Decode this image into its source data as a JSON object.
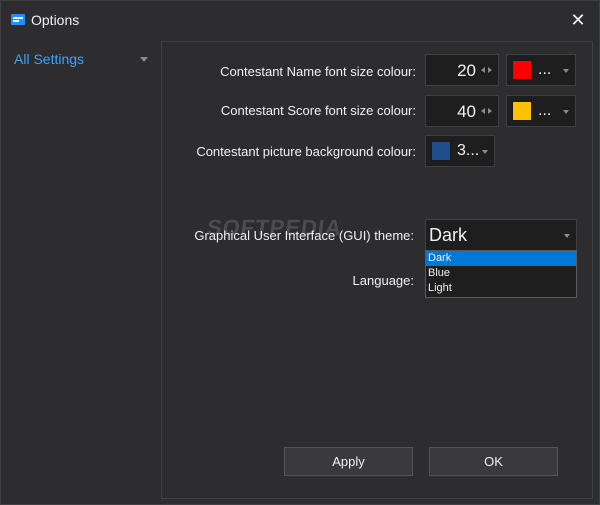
{
  "window": {
    "title": "Options",
    "close_glyph": "✕"
  },
  "sidebar": {
    "items": [
      {
        "label": "All Settings",
        "selected": true
      }
    ]
  },
  "settings": {
    "name_font": {
      "label": "Contestant Name font size  colour:",
      "size": "20",
      "color_text": "...",
      "swatch": "#ff0000"
    },
    "score_font": {
      "label": "Contestant Score font size  colour:",
      "size": "40",
      "color_text": "...",
      "swatch": "#ffc000"
    },
    "picture_bg": {
      "label": "Contestant picture background colour:",
      "color_text": "3...",
      "swatch": "#1f4e8c"
    },
    "theme": {
      "label": "Graphical User Interface (GUI) theme:",
      "value": "Dark",
      "options": [
        "Dark",
        "Blue",
        "Light"
      ],
      "selected_index": 0
    },
    "language": {
      "label": "Language:"
    }
  },
  "watermark": "SOFTPEDIA",
  "buttons": {
    "apply": "Apply",
    "ok": "OK"
  },
  "colors": {
    "background": "#2d2d30",
    "accent": "#3da2ff",
    "selection": "#0078d7"
  }
}
